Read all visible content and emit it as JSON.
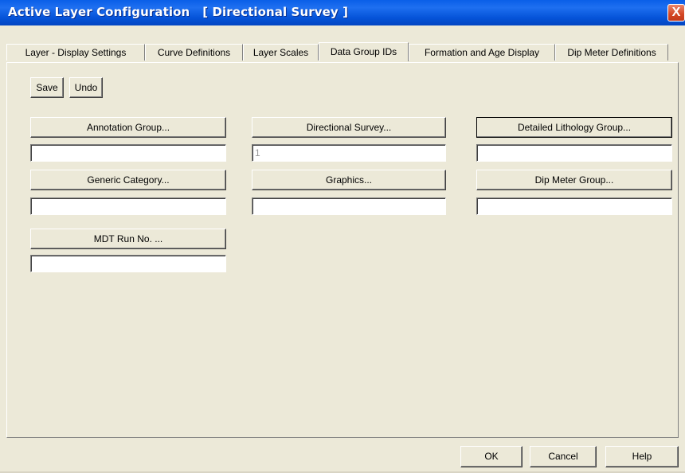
{
  "window": {
    "title": "Active Layer Configuration   [ Directional Survey ]",
    "close_label": "X"
  },
  "tabs": [
    {
      "label": "Layer - Display Settings"
    },
    {
      "label": "Curve Definitions"
    },
    {
      "label": "Layer Scales"
    },
    {
      "label": "Data Group IDs"
    },
    {
      "label": "Formation and Age Display"
    },
    {
      "label": "Dip Meter Definitions"
    }
  ],
  "active_tab": "Data Group IDs",
  "toolbar": {
    "save_label": "Save",
    "undo_label": "Undo"
  },
  "groups": {
    "annotation": {
      "label": "Annotation Group...",
      "value": ""
    },
    "directional_survey": {
      "label": "Directional Survey...",
      "value": "1"
    },
    "detailed_lithology": {
      "label": "Detailed Lithology Group...",
      "value": ""
    },
    "generic_category": {
      "label": "Generic Category...",
      "value": ""
    },
    "graphics": {
      "label": "Graphics...",
      "value": ""
    },
    "dip_meter": {
      "label": "Dip Meter Group...",
      "value": ""
    },
    "mdt_run": {
      "label": "MDT Run No. ...",
      "value": ""
    }
  },
  "footer": {
    "ok_label": "OK",
    "cancel_label": "Cancel",
    "help_label": "Help"
  }
}
